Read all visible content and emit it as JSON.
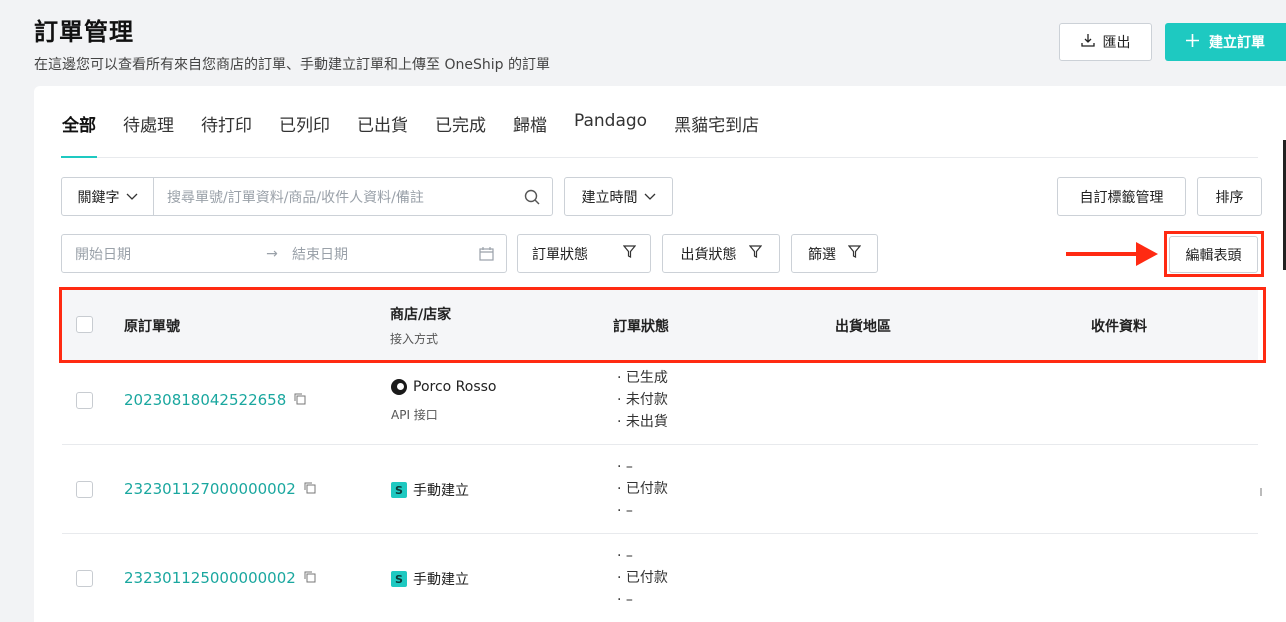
{
  "header": {
    "title": "訂單管理",
    "subtitle": "在這邊您可以查看所有來自您商店的訂單、手動建立訂單和上傳至 OneShip 的訂單",
    "export_label": "匯出",
    "create_label": "建立訂單"
  },
  "tabs": [
    {
      "label": "全部",
      "active": true
    },
    {
      "label": "待處理"
    },
    {
      "label": "待打印"
    },
    {
      "label": "已列印"
    },
    {
      "label": "已出貨"
    },
    {
      "label": "已完成"
    },
    {
      "label": "歸檔"
    },
    {
      "label": "Pandago"
    },
    {
      "label": "黑貓宅到店"
    }
  ],
  "filters": {
    "keyword_label": "關鍵字",
    "search_placeholder": "搜尋單號/訂單資料/商品/收件人資料/備註",
    "created_time_label": "建立時間",
    "tag_mgmt_label": "自訂標籤管理",
    "sort_label": "排序",
    "start_date_placeholder": "開始日期",
    "end_date_placeholder": "結束日期",
    "order_status_label": "訂單狀態",
    "ship_status_label": "出貨狀態",
    "filter_label": "篩選",
    "edit_header_label": "編輯表頭"
  },
  "table": {
    "columns": {
      "order_no": "原訂單號",
      "store": "商店/店家",
      "store_sub": "接入方式",
      "order_status": "訂單狀態",
      "ship_region": "出貨地區",
      "recipient": "收件資料"
    },
    "rows": [
      {
        "order_no": "20230818042522658",
        "store": "Porco Rosso",
        "store_sub": "API 接口",
        "status": [
          "· 已生成",
          "· 未付款",
          "· 未出貨"
        ]
      },
      {
        "order_no": "232301127000000002",
        "store": "手動建立",
        "store_sub": "",
        "status": [
          "· –",
          "· 已付款",
          "· –"
        ]
      },
      {
        "order_no": "232301125000000002",
        "store": "手動建立",
        "store_sub": "",
        "status": [
          "· –",
          "· 已付款",
          "· –"
        ]
      }
    ]
  },
  "colors": {
    "accent": "#1ec9c1",
    "link": "#1aa79f",
    "highlight": "#ff2a12"
  }
}
